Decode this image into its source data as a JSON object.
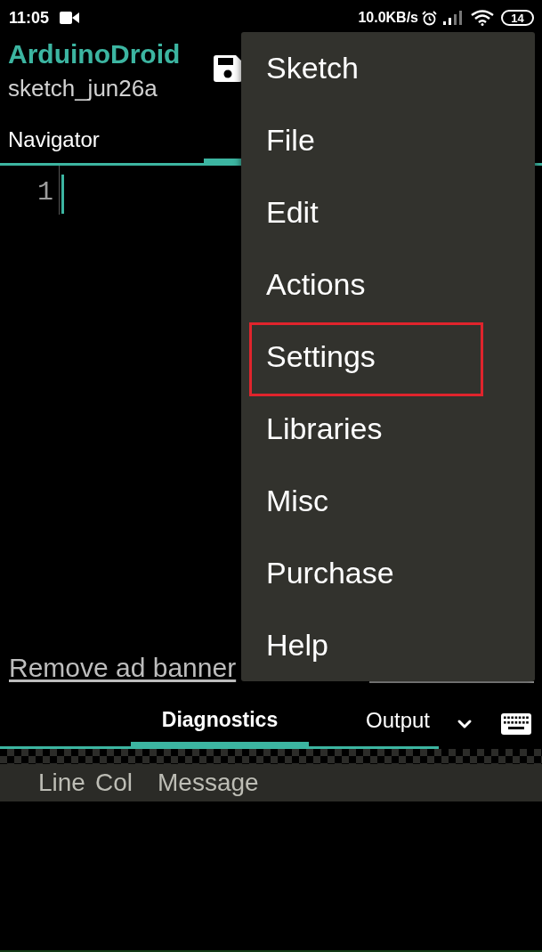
{
  "status_bar": {
    "time": "11:05",
    "network_speed": "10.0KB/s",
    "battery": "14"
  },
  "header": {
    "title": "ArduinoDroid",
    "subtitle": "sketch_jun26a"
  },
  "tabs": [
    {
      "label": "Navigator",
      "selected": false
    },
    {
      "selected": true
    }
  ],
  "editor": {
    "line_numbers": [
      "1"
    ]
  },
  "ad_link": "Remove ad banner",
  "bottom_tabs": [
    {
      "label": "Diagnostics",
      "selected": true
    },
    {
      "label": "Output",
      "selected": false
    }
  ],
  "diagnostics": {
    "columns": [
      "Line",
      "Col",
      "Message"
    ]
  },
  "menu": {
    "items": [
      {
        "label": "Sketch",
        "highlighted": false
      },
      {
        "label": "File",
        "highlighted": false
      },
      {
        "label": "Edit",
        "highlighted": false
      },
      {
        "label": "Actions",
        "highlighted": false
      },
      {
        "label": "Settings",
        "highlighted": true
      },
      {
        "label": "Libraries",
        "highlighted": false
      },
      {
        "label": "Misc",
        "highlighted": false
      },
      {
        "label": "Purchase",
        "highlighted": false
      },
      {
        "label": "Help",
        "highlighted": false
      }
    ]
  }
}
